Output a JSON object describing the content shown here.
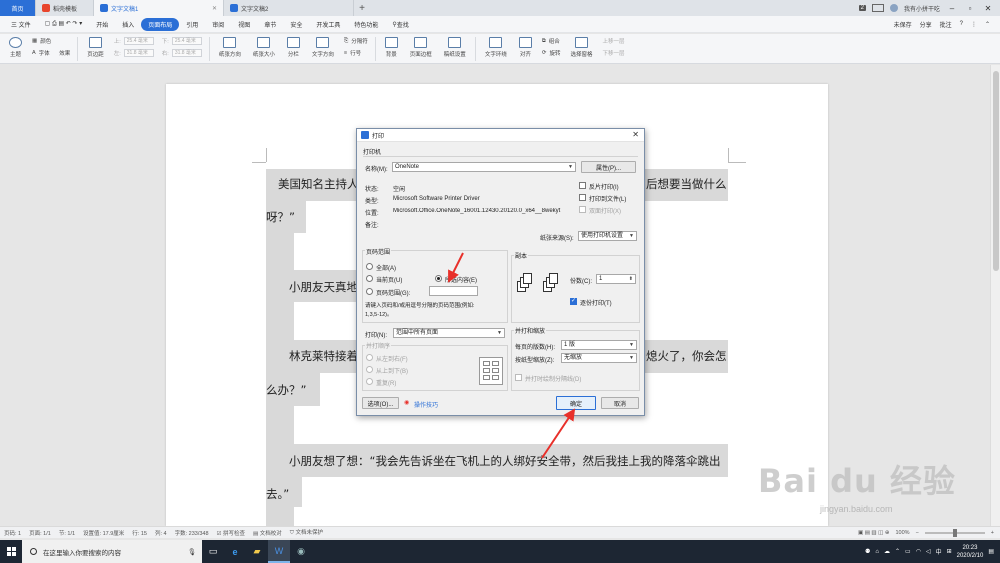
{
  "tabs": [
    {
      "label": "首页"
    },
    {
      "label": "稻壳模板"
    },
    {
      "label": "文字文稿1"
    },
    {
      "label": "文字文稿2"
    }
  ],
  "tabbar": {
    "badge": "2",
    "user": "我有小拼干吃"
  },
  "menu": {
    "file": "三 文件",
    "items": [
      "开始",
      "插入",
      "页面布局",
      "引用",
      "审阅",
      "视图",
      "章节",
      "安全",
      "开发工具",
      "特色功能"
    ],
    "search": "查找",
    "right": [
      "未保存",
      "分享",
      "批注"
    ]
  },
  "ribbon": {
    "theme": "主题",
    "colors": "颜色",
    "fonts": "字体",
    "effects": "效果",
    "margin": "页边距",
    "top_label": "上:",
    "top_value": "25.4 毫米",
    "bottom_label": "下:",
    "bottom_value": "25.4 毫米",
    "left_label": "左:",
    "left_value": "31.8 毫米",
    "right_label": "右:",
    "right_value": "31.8 毫米",
    "orientation": "纸张方向",
    "size": "纸张大小",
    "columns": "分栏",
    "text_direction": "文字方向",
    "breaks": "分隔符",
    "line_numbers": "行号",
    "background": "背景",
    "borders": "页面边框",
    "manuscript": "稿纸设置",
    "wrap": "文字环绕",
    "align": "对齐",
    "rotate": "旋转",
    "group": "组合",
    "selection": "选择窗格",
    "up": "上移一层",
    "down": "下移一层"
  },
  "document": {
    "line1": "美国知名主持人",
    "line1b": "后想要当做什么",
    "line2": "呀？”",
    "line3": "小朋友天真地",
    "line4": "林克莱特接着",
    "line4b": "熄火了，你会怎",
    "line5": "么办？”",
    "line6": "小朋友想了想：“我会先告诉坐在飞机上的人绑好安全带，然后我挂上我的降落伞跳出",
    "line7": "去。”"
  },
  "dialog": {
    "title": "打印",
    "printer_group": "打印机",
    "name_label": "名称(M):",
    "name_value": "OneNote",
    "properties": "属性(P)...",
    "status_label": "状态:",
    "status_value": "空闲",
    "type_label": "类型:",
    "type_value": "Microsoft Software Printer Driver",
    "location_label": "位置:",
    "location_value": "Microsoft.Office.OneNote_16001.12430.20120.0_x64__8wekyt",
    "comment_label": "备注:",
    "reverse": "反片打印(I)",
    "print_to_file": "打印到文件(L)",
    "duplex": "双面打印(X)",
    "paper_source_label": "纸张来源(S):",
    "paper_source_value": "使用打印机设置",
    "range_group": "页码范围",
    "all": "全部(A)",
    "current": "当前页(U)",
    "selection": "所选内容(E)",
    "pages": "页码范围(G):",
    "hint": "请键入页码和/或用逗号分隔的页码范围(例如:",
    "hint2": "1,3,5-12)。",
    "copies_group": "副本",
    "copies_label": "份数(C):",
    "copies_value": "1",
    "collate": "逐份打印(T)",
    "print_label": "打印(N):",
    "print_value": "范围中所有页面",
    "order_label": "并打顺序",
    "order_lr": "从左到右(F)",
    "order_tb": "从上到下(B)",
    "order_repeat": "重复(R)",
    "zoom_group": "并打和缩放",
    "per_sheet_label": "每页的版数(H):",
    "per_sheet_value": "1 版",
    "scale_label": "按纸型缩放(Z):",
    "scale_value": "无缩放",
    "draw_borders": "并打时绘制分隔线(D)",
    "options": "选项(O)...",
    "tips": "操作技巧",
    "ok": "确定",
    "cancel": "取消"
  },
  "status": {
    "page": "页码: 1",
    "pages": "页面: 1/1",
    "section": "节: 1/1",
    "setting": "设置值: 17.9厘米",
    "row": "行: 15",
    "column": "列: 4",
    "words": "字数: 233/348",
    "spell": "拼写检查",
    "proof": "文档校对",
    "protect": "文档未保护",
    "zoom": "100%"
  },
  "taskbar": {
    "search": "在这里输入你要搜索的内容",
    "time": "20:23",
    "date": "2020/2/10"
  },
  "watermark": {
    "logo": "Bai du 经验",
    "url": "jingyan.baidu.com"
  },
  "colors": {
    "accent": "#2b6fd6",
    "arrow": "#e8302a",
    "highlight": "#d9d9d9"
  }
}
